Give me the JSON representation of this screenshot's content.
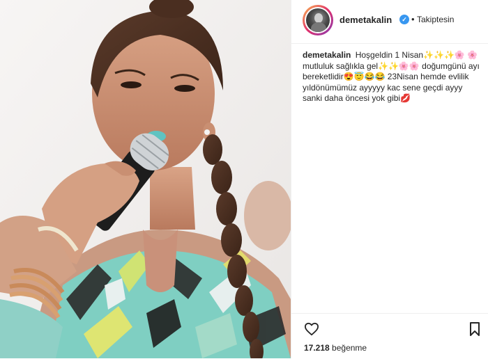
{
  "post": {
    "username": "demetakalin",
    "verified_icon": "verified-badge-icon",
    "separator": "•",
    "follow_status": "Takiptesin",
    "caption": {
      "username": "demetakalin",
      "text": "Hoşgeldin 1 Nisan✨✨✨🌸 🌸mutluluk sağlıkla gel✨✨🌸🌸 doğumgünü ayı bereketlidir😍😇😂😂 23Nisan hemde evlilik yıldönümümüz ayyyyy kac sene geçdi ayyy sanki daha öncesi yok gibi💋"
    },
    "likes_count": "17.218",
    "likes_label": "beğenme",
    "icons": {
      "like": "heart-icon",
      "save": "bookmark-icon"
    }
  },
  "colors": {
    "verified": "#3897f0",
    "text": "#262626",
    "divider": "#efefef"
  }
}
